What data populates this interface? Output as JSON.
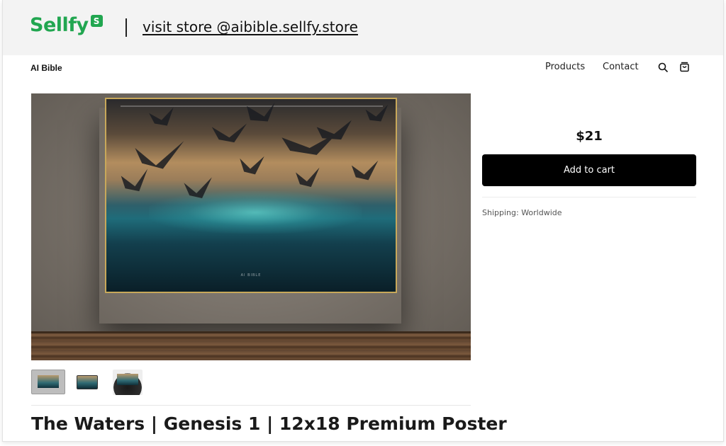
{
  "banner": {
    "logo_text": "Sellfy",
    "logo_badge": "S",
    "visit_text": "visit store @aibible.sellfy.store",
    "brand_color": "#21a650"
  },
  "nav": {
    "store_name": "AI Bible",
    "links": [
      "Products",
      "Contact"
    ],
    "icons": [
      "search-icon",
      "cart-icon"
    ]
  },
  "product": {
    "title": "The Waters | Genesis 1 | 12x18 Premium Poster",
    "price": "$21",
    "add_to_cart_label": "Add to cart",
    "shipping": "Shipping: Worldwide",
    "poster_caption": "AI BIBLE",
    "thumbnails": [
      "thumbnail-wall-mockup",
      "thumbnail-poster",
      "thumbnail-held-poster"
    ]
  }
}
